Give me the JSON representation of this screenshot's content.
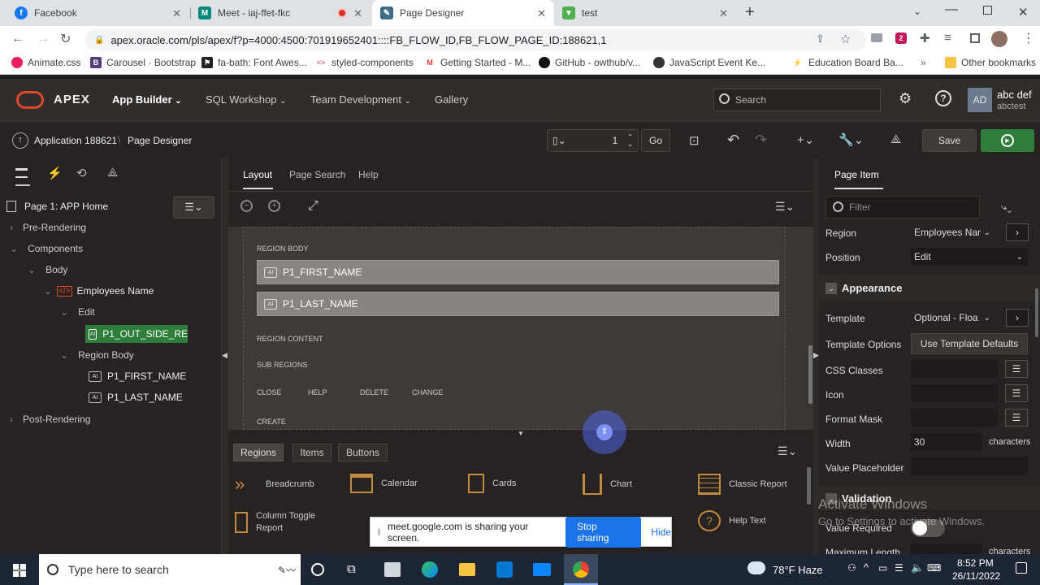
{
  "browser": {
    "tabs": [
      {
        "label": "Facebook",
        "color": "#1877f2",
        "glyph": "f"
      },
      {
        "label": "Meet - iaj-ffet-fkc",
        "color": "#00897b",
        "glyph": "M"
      },
      {
        "label": "Page Designer",
        "color": "#3f6f84",
        "glyph": ""
      },
      {
        "label": "test",
        "color": "#4caf50",
        "glyph": ""
      }
    ],
    "url": "apex.oracle.com/pls/apex/f?p=4000:4500:701919652401::::FB_FLOW_ID,FB_FLOW_PAGE_ID:188621,1",
    "bookmarks": [
      "Animate.css",
      "Carousel · Bootstrap",
      "fa-bath: Font Awes...",
      "styled-components",
      "Getting Started - M...",
      "GitHub - owthub/v...",
      "JavaScript Event Ke...",
      "Education Board Ba..."
    ],
    "other_bookmarks": "Other bookmarks"
  },
  "apex": {
    "logo": "APEX",
    "nav": [
      "App Builder",
      "SQL Workshop",
      "Team Development",
      "Gallery"
    ],
    "search_placeholder": "Search",
    "user_initials": "AD",
    "user_name": "abc def",
    "user_sub": "abctest"
  },
  "toolbar": {
    "breadcrumb_app": "Application 188621",
    "breadcrumb_sep": "\\",
    "breadcrumb_page": "Page Designer",
    "page_number": "1",
    "go": "Go",
    "save": "Save"
  },
  "left": {
    "page_title": "Page 1: APP Home",
    "tree": [
      {
        "label": "Pre-Rendering"
      },
      {
        "label": "Components"
      },
      {
        "label": "Body"
      },
      {
        "label": "Employees Name"
      },
      {
        "label": "Edit"
      },
      {
        "label": "P1_OUT_SIDE_RE"
      },
      {
        "label": "Region Body"
      },
      {
        "label": "P1_FIRST_NAME"
      },
      {
        "label": "P1_LAST_NAME"
      },
      {
        "label": "Post-Rendering"
      }
    ]
  },
  "center": {
    "tabs": [
      "Layout",
      "Page Search",
      "Help"
    ],
    "region_body": "REGION BODY",
    "items": [
      "P1_FIRST_NAME",
      "P1_LAST_NAME"
    ],
    "region_content": "REGION CONTENT",
    "sub_regions": "SUB REGIONS",
    "buttons": [
      "CLOSE",
      "HELP",
      "DELETE",
      "CHANGE"
    ],
    "create": "CREATE",
    "gallery_tabs": [
      "Regions",
      "Items",
      "Buttons"
    ],
    "gallery": [
      "Breadcrumb",
      "Calendar",
      "Cards",
      "Chart",
      "Classic Report",
      "Column Toggle Report",
      "Help Text"
    ]
  },
  "right": {
    "tab": "Page Item",
    "filter_placeholder": "Filter",
    "region_label": "Region",
    "region_value": "Employees Nar",
    "position_label": "Position",
    "position_value": "Edit",
    "appearance": "Appearance",
    "template_label": "Template",
    "template_value": "Optional - Floa",
    "template_options_label": "Template Options",
    "template_options_value": "Use Template Defaults",
    "css_label": "CSS Classes",
    "icon_label": "Icon",
    "format_mask_label": "Format Mask",
    "width_label": "Width",
    "width_value": "30",
    "width_unit": "characters",
    "placeholder_label": "Value Placeholder",
    "validation": "Validation",
    "value_required": "Value Required",
    "max_length": "Maximum Length",
    "max_length_unit": "characters"
  },
  "watermark": {
    "line1": "Activate Windows",
    "line2": "Go to Settings to activate Windows."
  },
  "sharing": {
    "text": "meet.google.com is sharing your screen.",
    "stop": "Stop sharing",
    "hide": "Hide"
  },
  "taskbar": {
    "search": "Type here to search",
    "weather": "78°F Haze",
    "time": "8:52 PM",
    "date": "26/11/2022"
  }
}
